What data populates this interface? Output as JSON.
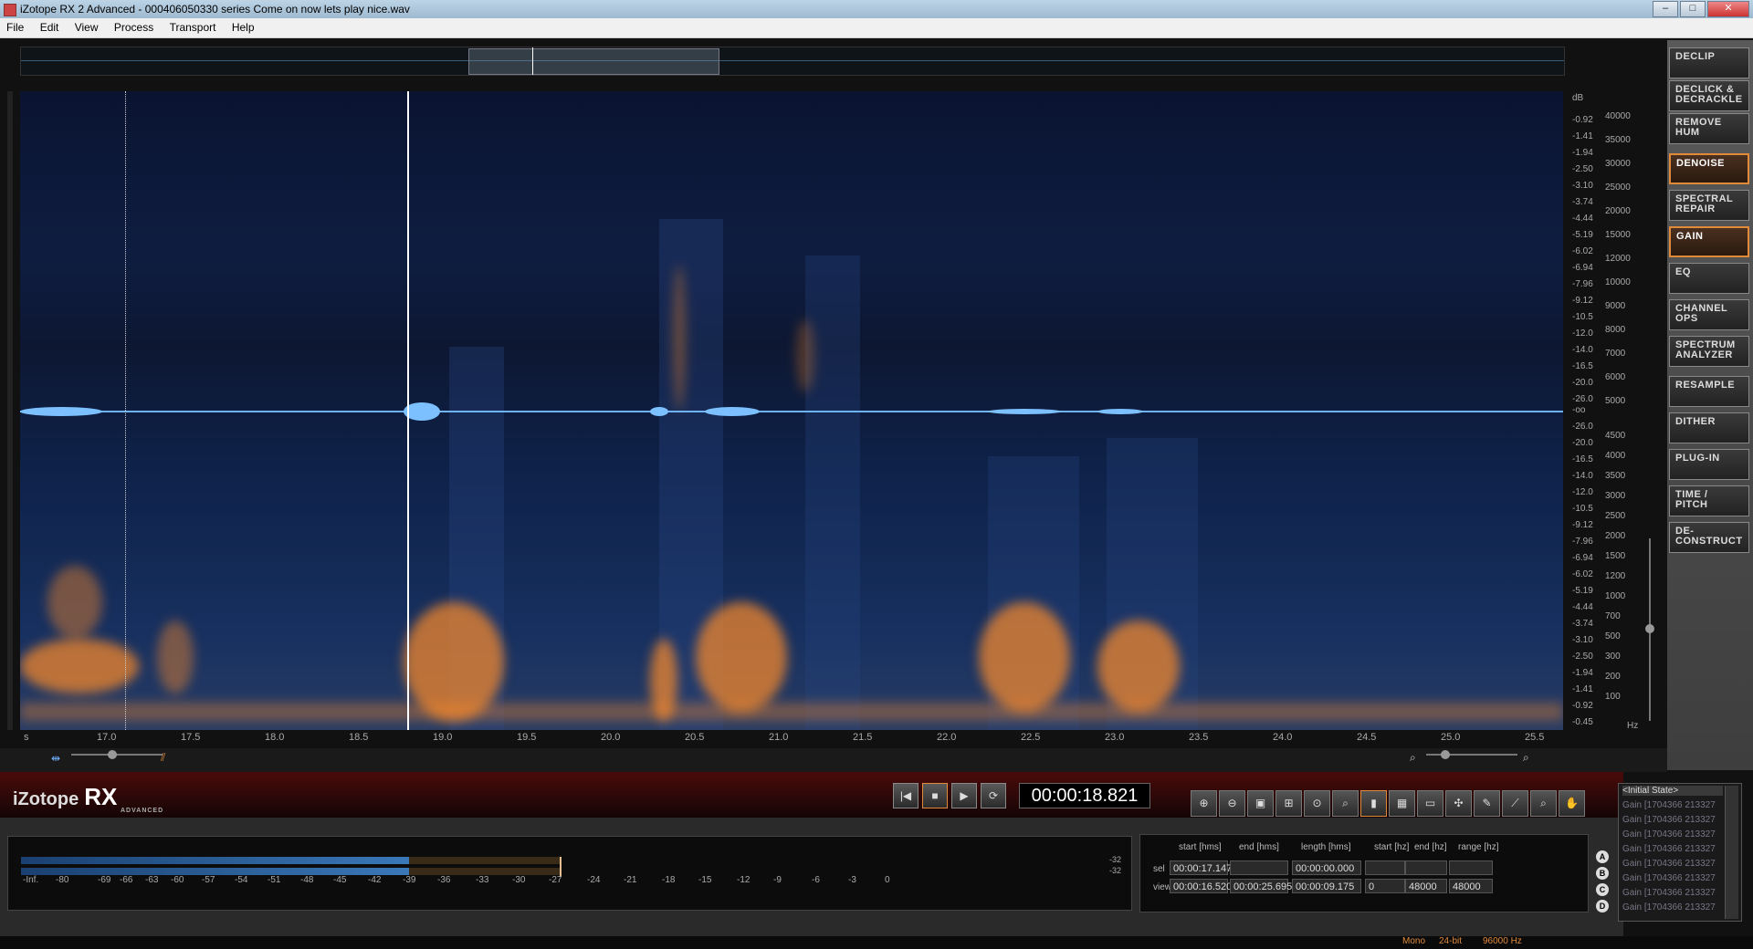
{
  "window": {
    "title": "iZotope RX 2 Advanced - 000406050330 series Come on now lets play nice.wav",
    "controls": [
      "–",
      "□",
      "✕"
    ]
  },
  "menu": [
    "File",
    "Edit",
    "View",
    "Process",
    "Transport",
    "Help"
  ],
  "modules": [
    {
      "label": "DECLIP",
      "active": false
    },
    {
      "label": "DECLICK & DECRACKLE",
      "active": false
    },
    {
      "label": "REMOVE HUM",
      "active": false
    },
    {
      "label": "DENOISE",
      "active": true
    },
    {
      "label": "SPECTRAL REPAIR",
      "active": false
    },
    {
      "label": "GAIN",
      "active": true
    },
    {
      "label": "EQ",
      "active": false
    },
    {
      "label": "CHANNEL OPS",
      "active": false
    },
    {
      "label": "SPECTRUM ANALYZER",
      "active": false
    },
    {
      "label": "RESAMPLE",
      "active": false
    },
    {
      "label": "DITHER",
      "active": false
    },
    {
      "label": "PLUG-IN",
      "active": false
    },
    {
      "label": "TIME / PITCH",
      "active": false
    },
    {
      "label": "DE-CONSTRUCT",
      "active": false
    }
  ],
  "db_scale": {
    "unit": "dB",
    "upper": [
      "-0.92",
      "-1.41",
      "-1.94",
      "-2.50",
      "-3.10",
      "-3.74",
      "-4.44",
      "-5.19",
      "-6.02",
      "-6.94",
      "-7.96",
      "-9.12",
      "-10.5",
      "-12.0",
      "-14.0",
      "-16.5",
      "-20.0",
      "-26.0"
    ],
    "center": "-oo",
    "lower": [
      "-26.0",
      "-20.0",
      "-16.5",
      "-14.0",
      "-12.0",
      "-10.5",
      "-9.12",
      "-7.96",
      "-6.94",
      "-6.02",
      "-5.19",
      "-4.44",
      "-3.74",
      "-3.10",
      "-2.50",
      "-1.94",
      "-1.41",
      "-0.92",
      "-0.45"
    ]
  },
  "hz_scale": {
    "unit": "Hz",
    "upper": [
      "40000",
      "35000",
      "30000",
      "25000",
      "20000",
      "15000",
      "12000",
      "10000",
      "9000",
      "8000",
      "7000",
      "6000",
      "5000"
    ],
    "lower": [
      "4500",
      "4000",
      "3500",
      "3000",
      "2500",
      "2000",
      "1500",
      "1200",
      "1000",
      "700",
      "500",
      "300",
      "200",
      "100"
    ]
  },
  "time_axis": {
    "unit": "s",
    "ticks": [
      "17.0",
      "17.5",
      "18.0",
      "18.5",
      "19.0",
      "19.5",
      "20.0",
      "20.5",
      "21.0",
      "21.5",
      "22.0",
      "22.5",
      "23.0",
      "23.5",
      "24.0",
      "24.5",
      "25.0",
      "25.5"
    ]
  },
  "logo": {
    "brand": "iZotope",
    "product": "RX",
    "edition": "ADVANCED"
  },
  "transport": {
    "buttons": [
      "|◀",
      "■",
      "▶",
      "⟳"
    ],
    "time": "00:00:18.821"
  },
  "tools": [
    "⊕",
    "⊖",
    "▣",
    "⊞",
    "⊙",
    "⌕",
    "▮",
    "▦",
    "▭",
    "✣",
    "✎",
    "⟋",
    "⌕",
    "✋"
  ],
  "meter": {
    "scale": [
      "-Inf.",
      "-80",
      "-69",
      "-66",
      "-63",
      "-60",
      "-57",
      "-54",
      "-51",
      "-48",
      "-45",
      "-42",
      "-39",
      "-36",
      "-33",
      "-30",
      "-27",
      "-24",
      "-21",
      "-18",
      "-15",
      "-12",
      "-9",
      "-6",
      "-3",
      "0"
    ],
    "peak_labels": [
      "-32",
      "-32"
    ],
    "level_fraction": 0.36,
    "peak_fraction": 0.5
  },
  "selection": {
    "headers": [
      "start [hms]",
      "end [hms]",
      "length [hms]",
      "start [hz]",
      "end [hz]",
      "range [hz]"
    ],
    "sel_label": "sel",
    "view_label": "view",
    "sel": [
      "00:00:17.147",
      "",
      "00:00:00.000",
      "",
      "",
      ""
    ],
    "view": [
      "00:00:16.520",
      "00:00:25.695",
      "00:00:09.175",
      "0",
      "48000",
      "48000"
    ]
  },
  "history": {
    "items": [
      "<Initial State>",
      "Gain [1704366 213327",
      "Gain [1704366 213327",
      "Gain [1704366 213327",
      "Gain [1704366 213327",
      "Gain [1704366 213327",
      "Gain [1704366 213327",
      "Gain [1704366 213327",
      "Gain [1704366 213327"
    ]
  },
  "compare": [
    "A",
    "B",
    "C",
    "D"
  ],
  "status": [
    "Mono",
    "24-bit",
    "96000 Hz"
  ],
  "colors": {
    "accent": "#e08a3a",
    "waveform": "#6fb3ff",
    "spectrogram_hot": "#ff8c28"
  }
}
